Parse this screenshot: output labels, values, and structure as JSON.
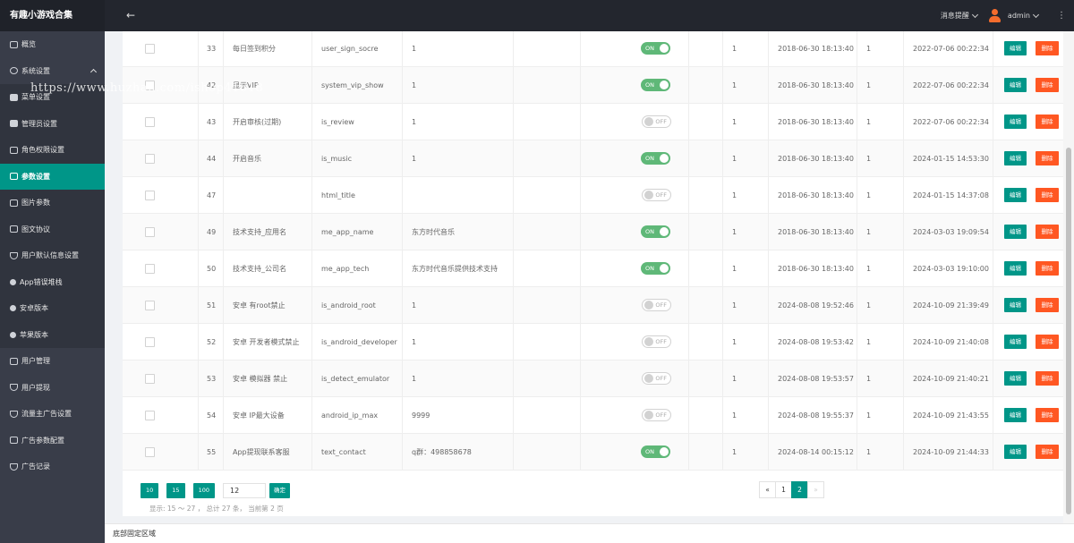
{
  "app": {
    "title": "有趣小游戏合集"
  },
  "header": {
    "notice": "消息提醒",
    "user": "admin",
    "more": "⋮",
    "back": "←"
  },
  "sidebar": {
    "items": [
      {
        "label": "概览",
        "icon": "dashboard-icon",
        "type": "top"
      },
      {
        "label": "系统设置",
        "icon": "gear-icon",
        "type": "group"
      },
      {
        "label": "菜单设置",
        "icon": "menu-icon",
        "type": "sub"
      },
      {
        "label": "管理员设置",
        "icon": "admin-icon",
        "type": "sub"
      },
      {
        "label": "角色权限设置",
        "icon": "role-icon",
        "type": "sub"
      },
      {
        "label": "参数设置",
        "icon": "param-icon",
        "type": "active"
      },
      {
        "label": "图片参数",
        "icon": "image-icon",
        "type": "sub"
      },
      {
        "label": "图文协议",
        "icon": "doc-icon",
        "type": "sub"
      },
      {
        "label": "用户默认信息设置",
        "icon": "shield-icon",
        "type": "sub"
      },
      {
        "label": "App错误堆栈",
        "icon": "diamond-icon",
        "type": "sub"
      },
      {
        "label": "安卓版本",
        "icon": "android-icon",
        "type": "sub"
      },
      {
        "label": "苹果版本",
        "icon": "apple-icon",
        "type": "sub"
      },
      {
        "label": "用户管理",
        "icon": "user-icon",
        "type": "top"
      },
      {
        "label": "用户提现",
        "icon": "withdraw-icon",
        "type": "top"
      },
      {
        "label": "流量主广告设置",
        "icon": "ad-icon",
        "type": "top"
      },
      {
        "label": "广告参数配置",
        "icon": "ad-config-icon",
        "type": "top"
      },
      {
        "label": "广告记录",
        "icon": "record-icon",
        "type": "top"
      }
    ]
  },
  "table": {
    "rows": [
      {
        "id": "33",
        "name": "每日签到积分",
        "key": "user_sign_socre",
        "value": "1",
        "status": "ON",
        "type": "1",
        "created": "2018-06-30 18:13:40",
        "editor": "1",
        "updated": "2022-07-06 00:22:34"
      },
      {
        "id": "42",
        "name": "显示VIP",
        "key": "system_vip_show",
        "value": "1",
        "status": "ON",
        "type": "1",
        "created": "2018-06-30 18:13:40",
        "editor": "1",
        "updated": "2022-07-06 00:22:34"
      },
      {
        "id": "43",
        "name": "开启审核(过期)",
        "key": "is_review",
        "value": "1",
        "status": "OFF",
        "type": "1",
        "created": "2018-06-30 18:13:40",
        "editor": "1",
        "updated": "2022-07-06 00:22:34"
      },
      {
        "id": "44",
        "name": "开启音乐",
        "key": "is_music",
        "value": "1",
        "status": "ON",
        "type": "1",
        "created": "2018-06-30 18:13:40",
        "editor": "1",
        "updated": "2024-01-15 14:53:30"
      },
      {
        "id": "47",
        "name": "",
        "key": "html_title",
        "value": "",
        "status": "OFF",
        "type": "1",
        "created": "2018-06-30 18:13:40",
        "editor": "1",
        "updated": "2024-01-15 14:37:08"
      },
      {
        "id": "49",
        "name": "技术支持_应用名",
        "key": "me_app_name",
        "value": "东方时代音乐",
        "status": "ON",
        "type": "1",
        "created": "2018-06-30 18:13:40",
        "editor": "1",
        "updated": "2024-03-03 19:09:54"
      },
      {
        "id": "50",
        "name": "技术支持_公司名",
        "key": "me_app_tech",
        "value": "东方时代音乐提供技术支持",
        "status": "ON",
        "type": "1",
        "created": "2018-06-30 18:13:40",
        "editor": "1",
        "updated": "2024-03-03 19:10:00"
      },
      {
        "id": "51",
        "name": "安卓 有root禁止",
        "key": "is_android_root",
        "value": "1",
        "status": "OFF",
        "type": "1",
        "created": "2024-08-08 19:52:46",
        "editor": "1",
        "updated": "2024-10-09 21:39:49"
      },
      {
        "id": "52",
        "name": "安卓 开发者模式禁止",
        "key": "is_android_developer",
        "value": "1",
        "status": "OFF",
        "type": "1",
        "created": "2024-08-08 19:53:42",
        "editor": "1",
        "updated": "2024-10-09 21:40:08"
      },
      {
        "id": "53",
        "name": "安卓 模拟器 禁止",
        "key": "is_detect_emulator",
        "value": "1",
        "status": "OFF",
        "type": "1",
        "created": "2024-08-08 19:53:57",
        "editor": "1",
        "updated": "2024-10-09 21:40:21"
      },
      {
        "id": "54",
        "name": "安卓 IP最大设备",
        "key": "android_ip_max",
        "value": "9999",
        "status": "OFF",
        "type": "1",
        "created": "2024-08-08 19:55:37",
        "editor": "1",
        "updated": "2024-10-09 21:43:55"
      },
      {
        "id": "55",
        "name": "App提现联系客服",
        "key": "text_contact",
        "value": "q群：498858678",
        "status": "ON",
        "type": "1",
        "created": "2024-08-14 00:15:12",
        "editor": "1",
        "updated": "2024-10-09 21:44:33"
      }
    ],
    "edit_label": "编辑",
    "delete_label": "删除"
  },
  "pager": {
    "sizes": [
      "10",
      "15",
      "100"
    ],
    "input_value": "12",
    "confirm": "确定",
    "info": "显示: 15 ～ 27 ， 总计 27 条， 当前第 2 页",
    "prev": "«",
    "pages": [
      "1",
      "2"
    ],
    "current": "2",
    "next": "»"
  },
  "footer": {
    "text": "底部固定区域"
  },
  "watermark": "https://www.huzhan.com/ishop41618"
}
